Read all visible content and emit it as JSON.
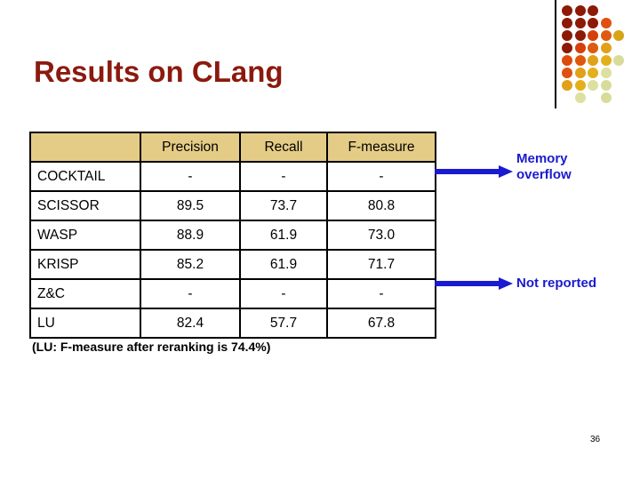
{
  "slide": {
    "title": "Results on CLang",
    "page_number": "36",
    "footnote": "(LU: F-measure after reranking is 74.4%)",
    "title_color": "#8B1A0E",
    "accent_color": "#1A1AD0",
    "header_fill": "#E5CC86"
  },
  "table": {
    "corner_header": "",
    "columns": [
      "Precision",
      "Recall",
      "F-measure"
    ],
    "rows": [
      {
        "system": "COCKTAIL",
        "precision": "-",
        "recall": "-",
        "f_measure": "-"
      },
      {
        "system": "SCISSOR",
        "precision": "89.5",
        "recall": "73.7",
        "f_measure": "80.8"
      },
      {
        "system": "WASP",
        "precision": "88.9",
        "recall": "61.9",
        "f_measure": "73.0"
      },
      {
        "system": "KRISP",
        "precision": "85.2",
        "recall": "61.9",
        "f_measure": "71.7"
      },
      {
        "system": "Z&C",
        "precision": "-",
        "recall": "-",
        "f_measure": "-"
      },
      {
        "system": "LU",
        "precision": "82.4",
        "recall": "57.7",
        "f_measure": "67.8"
      }
    ]
  },
  "annotations": [
    {
      "id": "memory-overflow",
      "label": "Memory overflow",
      "target_row": "COCKTAIL"
    },
    {
      "id": "not-reported",
      "label": "Not reported",
      "target_row": "Z&C"
    }
  ],
  "decoration": {
    "dot_grid": [
      [
        "#8C1A06",
        "#8C1A06",
        "#8C1A06",
        null,
        null
      ],
      [
        "#8C1A06",
        "#8C1A06",
        "#8C1A06",
        "#E0500F",
        null
      ],
      [
        "#8C1A06",
        "#8C1A06",
        "#D4400C",
        "#DE5A10",
        "#D9A316"
      ],
      [
        "#8C1A06",
        "#D4400C",
        "#DE5A10",
        "#E0A019",
        null
      ],
      [
        "#DE4A0C",
        "#E0560E",
        "#E0A019",
        "#E3B01C",
        "#D8DC9A"
      ],
      [
        "#E0500F",
        "#E0A019",
        "#E3B01C",
        "#DCE0A0",
        null
      ],
      [
        "#E0A019",
        "#E3B01C",
        "#DCE0A0",
        "#D8DC9A",
        null
      ],
      [
        null,
        "#DCE0A0",
        null,
        "#D8DC9A",
        null
      ]
    ]
  }
}
